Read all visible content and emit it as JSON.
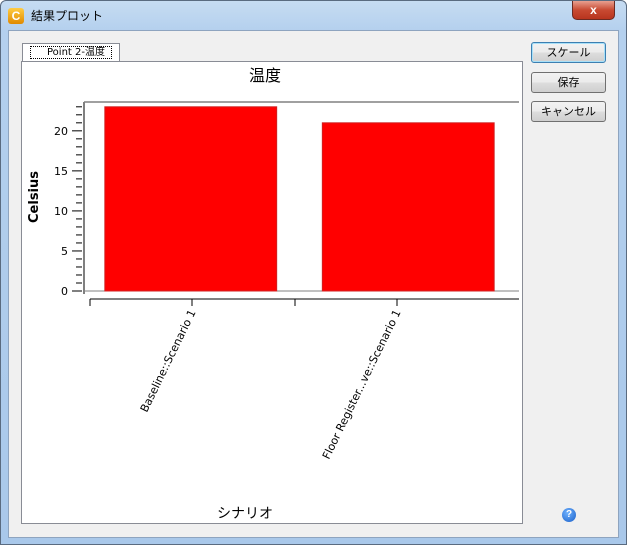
{
  "window": {
    "title": "結果プロット",
    "close_label": "x"
  },
  "tab": {
    "label": "Point 2-温度"
  },
  "buttons": {
    "scale": "スケール",
    "save": "保存",
    "cancel": "キャンセル",
    "help": "?"
  },
  "chart_data": {
    "type": "bar",
    "title": "温度",
    "xlabel": "シナリオ",
    "ylabel": "Celsius",
    "categories": [
      "Baseline::Scenario 1",
      "Floor Register...ve::Scenario 1"
    ],
    "values": [
      23,
      21
    ],
    "ylim": [
      0,
      23.6
    ],
    "yticks": [
      0,
      5,
      10,
      15,
      20
    ],
    "color": "#ff0000",
    "legend": "none"
  }
}
